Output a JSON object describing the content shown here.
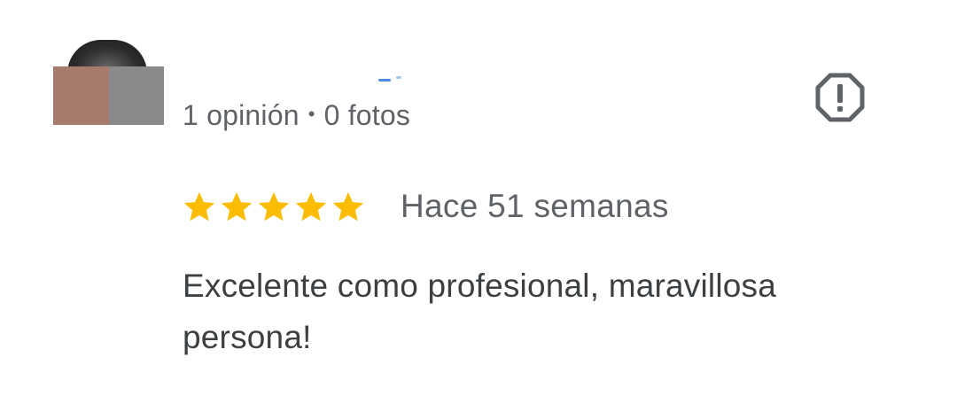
{
  "review": {
    "author_name_redacted": true,
    "meta": {
      "opinions": "1 opinión",
      "separator": "•",
      "photos": "0 fotos"
    },
    "report_icon": "report-flag-octagon-exclamation-icon",
    "rating": {
      "stars": 5,
      "max_stars": 5,
      "star_color": "#fbbc04"
    },
    "time_ago": "Hace 51 semanas",
    "text": "Excelente como profesional, maravillosa persona!"
  },
  "colors": {
    "secondary_text": "#5f6368",
    "primary_text": "#3c4043",
    "icon": "#5f6368"
  }
}
